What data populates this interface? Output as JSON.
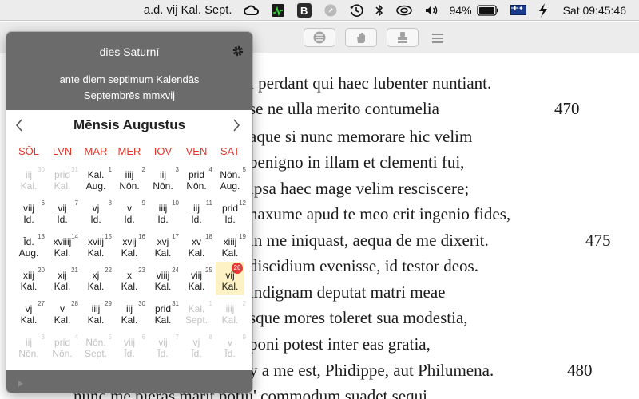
{
  "menubar": {
    "date_label": "a.d. vij Kal. Sept.",
    "battery": "94%",
    "clock": "Sat 09:45:46",
    "icons": [
      "creative-cloud-icon",
      "activity-monitor-icon",
      "b-app-icon",
      "compass-icon",
      "time-machine-icon",
      "bluetooth-icon",
      "wifi-icon",
      "volume-icon",
      "battery-icon",
      "australia-flag-icon",
      "bolt-icon"
    ]
  },
  "popover": {
    "weekday": "dies Saturnī",
    "date_line1": "ante diem septimum Kalendās",
    "date_line2": "Septembrēs mmxvij",
    "month_title": "Mēnsis Augustus",
    "day_headers": [
      "SŌL",
      "LVN",
      "MAR",
      "MER",
      "IOV",
      "VEN",
      "SAT"
    ],
    "today_badge": "26",
    "weeks": [
      [
        {
          "n": "30",
          "a": "iij",
          "b": "Kal.",
          "dim": true
        },
        {
          "n": "31",
          "a": "prid",
          "b": "Kal.",
          "dim": true
        },
        {
          "n": "1",
          "a": "Kal.",
          "b": "Aug."
        },
        {
          "n": "2",
          "a": "iiij",
          "b": "Nōn."
        },
        {
          "n": "3",
          "a": "iij",
          "b": "Nōn."
        },
        {
          "n": "4",
          "a": "prid",
          "b": "Nōn."
        },
        {
          "n": "5",
          "a": "Nōn.",
          "b": "Aug."
        }
      ],
      [
        {
          "n": "6",
          "a": "viij",
          "b": "Īd."
        },
        {
          "n": "7",
          "a": "vij",
          "b": "Īd."
        },
        {
          "n": "8",
          "a": "vj",
          "b": "Īd."
        },
        {
          "n": "9",
          "a": "v",
          "b": "Īd."
        },
        {
          "n": "10",
          "a": "iiij",
          "b": "Īd."
        },
        {
          "n": "11",
          "a": "iij",
          "b": "Īd."
        },
        {
          "n": "12",
          "a": "prid",
          "b": "Īd."
        }
      ],
      [
        {
          "n": "13",
          "a": "Īd.",
          "b": "Aug."
        },
        {
          "n": "14",
          "a": "xviiij",
          "b": "Kal."
        },
        {
          "n": "15",
          "a": "xviij",
          "b": "Kal."
        },
        {
          "n": "16",
          "a": "xvij",
          "b": "Kal."
        },
        {
          "n": "17",
          "a": "xvj",
          "b": "Kal."
        },
        {
          "n": "18",
          "a": "xv",
          "b": "Kal."
        },
        {
          "n": "19",
          "a": "xiiij",
          "b": "Kal."
        }
      ],
      [
        {
          "n": "20",
          "a": "xiij",
          "b": "Kal."
        },
        {
          "n": "21",
          "a": "xij",
          "b": "Kal."
        },
        {
          "n": "22",
          "a": "xj",
          "b": "Kal."
        },
        {
          "n": "23",
          "a": "x",
          "b": "Kal."
        },
        {
          "n": "24",
          "a": "viiij",
          "b": "Kal."
        },
        {
          "n": "25",
          "a": "viij",
          "b": "Kal."
        },
        {
          "n": "26",
          "a": "vij",
          "b": "Kal.",
          "today": true
        }
      ],
      [
        {
          "n": "27",
          "a": "vj",
          "b": "Kal."
        },
        {
          "n": "28",
          "a": "v",
          "b": "Kal."
        },
        {
          "n": "29",
          "a": "iiij",
          "b": "Kal."
        },
        {
          "n": "30",
          "a": "iij",
          "b": "Kal."
        },
        {
          "n": "31",
          "a": "prid",
          "b": "Kal."
        },
        {
          "n": "1",
          "a": "Kal.",
          "b": "Sept.",
          "dim": true
        },
        {
          "n": "2",
          "a": "iiij",
          "b": "Kal.",
          "dim": true
        }
      ],
      [
        {
          "n": "3",
          "a": "iij",
          "b": "Nōn.",
          "dim": true
        },
        {
          "n": "4",
          "a": "prid",
          "b": "Nōn.",
          "dim": true
        },
        {
          "n": "5",
          "a": "Nōn.",
          "b": "Sept.",
          "dim": true
        },
        {
          "n": "6",
          "a": "viij",
          "b": "Īd.",
          "dim": true
        },
        {
          "n": "7",
          "a": "vij",
          "b": "Īd.",
          "dim": true
        },
        {
          "n": "8",
          "a": "vj",
          "b": "Īd.",
          "dim": true
        },
        {
          "n": "9",
          "a": "v",
          "b": "Īd.",
          "dim": true
        }
      ]
    ]
  },
  "document": {
    "lines": [
      {
        "text": "i perdant qui haec lubenter nuntiant.",
        "num": ""
      },
      {
        "text": "se ne ulla merito contumelia",
        "num": "470"
      },
      {
        "text": "aque si nunc memorare hic velim",
        "num": ""
      },
      {
        "text": "benigno in illam et clementi fui,",
        "num": ""
      },
      {
        "text": "ipsa haec mage velim resciscere;",
        "num": ""
      },
      {
        "text": "naxume apud te meo erit ingenio fides,",
        "num": ""
      },
      {
        "text": "in me iniquast, aequa de me dixerit.",
        "num": "475"
      },
      {
        "text": "discidium evenisse, id testor deos.",
        "num": ""
      },
      {
        "text": "indignam deputat matri meae",
        "num": ""
      },
      {
        "text": "sque mores toleret sua modestia,",
        "num": ""
      },
      {
        "text": "poni potest inter eas gratia,",
        "num": ""
      },
      {
        "text": "y a me est, Phidippe, aut Philumena.",
        "num": "480"
      },
      {
        "text": "nunc me pieras marit potiu' commodum suadet sequi",
        "num": ""
      }
    ]
  }
}
